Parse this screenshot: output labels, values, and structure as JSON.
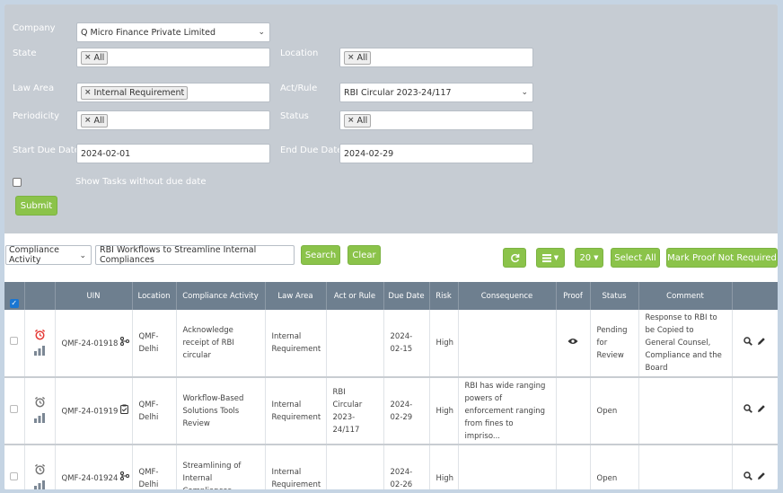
{
  "filters": {
    "company": {
      "label": "Company",
      "value": "Q Micro Finance Private Limited"
    },
    "state": {
      "label": "State",
      "tag": "All"
    },
    "location": {
      "label": "Location",
      "tag": "All"
    },
    "law_area": {
      "label": "Law Area",
      "tag": "Internal Requirement"
    },
    "act_rule": {
      "label": "Act/Rule",
      "value": "RBI Circular 2023-24/117"
    },
    "periodicity": {
      "label": "Periodicity",
      "tag": "All"
    },
    "status": {
      "label": "Status",
      "tag": "All"
    },
    "start_due_date": {
      "label": "Start Due Date",
      "value": "2024-02-01"
    },
    "end_due_date": {
      "label": "End Due Date",
      "value": "2024-02-29"
    },
    "show_without_due": "Show Tasks without due date",
    "submit": "Submit"
  },
  "toolbar": {
    "search_field": "Compliance Activity",
    "search_value": "RBI Workflows to Streamline Internal Compliances",
    "search_btn": "Search",
    "clear_btn": "Clear",
    "page_size": "20",
    "select_all": "Select All",
    "mark_proof": "Mark Proof Not Required"
  },
  "table": {
    "headers": [
      "UIN",
      "Location",
      "Compliance Activity",
      "Law Area",
      "Act or Rule",
      "Due Date",
      "Risk",
      "Consequence",
      "Proof",
      "Status",
      "Comment"
    ],
    "rows": [
      {
        "uin": "QMF-24-01918",
        "uin_icon": "flow-icon",
        "location": "QMF-Delhi",
        "activity": "Acknowledge receipt of RBI circular",
        "law_area": "Internal Requirement",
        "act": "",
        "due": "2024-02-15",
        "risk": "High",
        "consequence": "",
        "proof": true,
        "status": "Pending for Review",
        "comment": "Response to RBI to be Copied to General Counsel, Compliance and the Board",
        "alarm_color": "#e53935"
      },
      {
        "uin": "QMF-24-01919",
        "uin_icon": "clipboard-icon",
        "location": "QMF-Delhi",
        "activity": "Workflow-Based Solutions Tools Review",
        "law_area": "Internal Requirement",
        "act": "RBI Circular 2023-24/117",
        "due": "2024-02-29",
        "risk": "High",
        "consequence": "RBI has wide ranging powers of enforcement ranging from fines to impriso...",
        "proof": false,
        "status": "Open",
        "comment": "",
        "alarm_color": "#777777"
      },
      {
        "uin": "QMF-24-01924",
        "uin_icon": "flow-icon",
        "location": "QMF-Delhi",
        "activity": "Streamlining of Internal Compliances",
        "law_area": "Internal Requirement",
        "act": "",
        "due": "2024-02-26",
        "risk": "High",
        "consequence": "",
        "proof": false,
        "status": "Open",
        "comment": "",
        "alarm_color": "#777777"
      }
    ]
  }
}
